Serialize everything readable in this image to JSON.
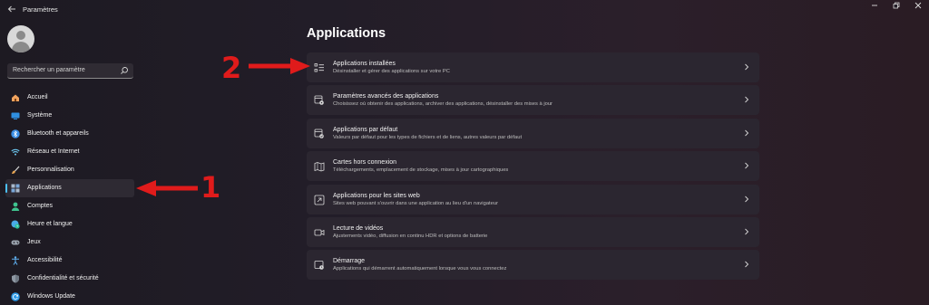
{
  "window": {
    "title": "Paramètres",
    "back_icon": "back-arrow-icon",
    "controls": [
      "minimize",
      "maximize",
      "close"
    ]
  },
  "sidebar": {
    "search_placeholder": "Rechercher un paramètre",
    "items": [
      {
        "label": "Accueil",
        "icon": "home-icon",
        "color": "#f0a35e"
      },
      {
        "label": "Système",
        "icon": "display-icon",
        "color": "#2f8fe0"
      },
      {
        "label": "Bluetooth et appareils",
        "icon": "bluetooth-icon",
        "color": "#3a8ee6"
      },
      {
        "label": "Réseau et Internet",
        "icon": "wifi-icon",
        "color": "#6cc7f0"
      },
      {
        "label": "Personnalisation",
        "icon": "brush-icon",
        "color": "#e8a552"
      },
      {
        "label": "Applications",
        "icon": "apps-icon",
        "color": "#7aa7d8",
        "active": true
      },
      {
        "label": "Comptes",
        "icon": "person-icon",
        "color": "#3fc48f"
      },
      {
        "label": "Heure et langue",
        "icon": "globe-clock-icon",
        "color": "#4aa9e8"
      },
      {
        "label": "Jeux",
        "icon": "gamepad-icon",
        "color": "#9aa3ad"
      },
      {
        "label": "Accessibilité",
        "icon": "accessibility-icon",
        "color": "#5fb0f0"
      },
      {
        "label": "Confidentialité et sécurité",
        "icon": "shield-icon",
        "color": "#8e98a3"
      },
      {
        "label": "Windows Update",
        "icon": "update-icon",
        "color": "#2f9be8"
      }
    ]
  },
  "main": {
    "title": "Applications",
    "cards": [
      {
        "title": "Applications installées",
        "subtitle": "Désinstaller et gérer des applications sur votre PC",
        "icon": "list-icon"
      },
      {
        "title": "Paramètres avancés des applications",
        "subtitle": "Choisissez où obtenir des applications, archiver des applications, désinstaller des mises à jour",
        "icon": "advanced-apps-icon"
      },
      {
        "title": "Applications par défaut",
        "subtitle": "Valeurs par défaut pour les types de fichiers et de liens, autres valeurs par défaut",
        "icon": "default-apps-icon"
      },
      {
        "title": "Cartes hors connexion",
        "subtitle": "Téléchargements, emplacement de stockage, mises à jour cartographiques",
        "icon": "map-icon"
      },
      {
        "title": "Applications pour les sites web",
        "subtitle": "Sites web pouvant s'ouvrir dans une application au lieu d'un navigateur",
        "icon": "open-external-icon"
      },
      {
        "title": "Lecture de vidéos",
        "subtitle": "Ajustements vidéo, diffusion en continu HDR et options de batterie",
        "icon": "video-icon"
      },
      {
        "title": "Démarrage",
        "subtitle": "Applications qui démarrent automatiquement lorsque vous vous connectez",
        "icon": "startup-icon"
      }
    ]
  },
  "annotations": {
    "step1": "1",
    "step2": "2",
    "color": "#e01b1b"
  }
}
